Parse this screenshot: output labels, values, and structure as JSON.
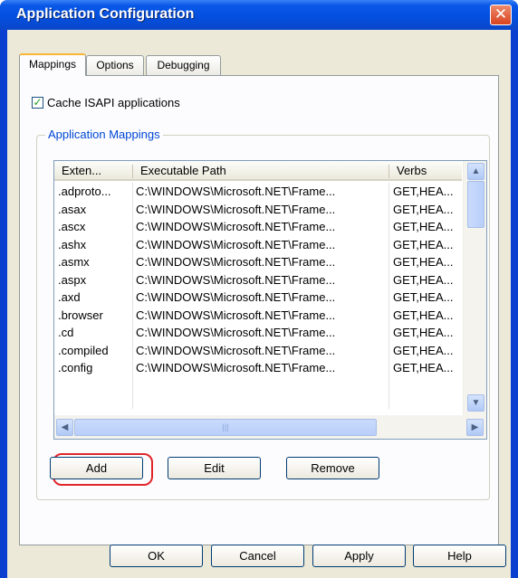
{
  "window": {
    "title": "Application Configuration",
    "close_glyph": "✕"
  },
  "tabs": [
    {
      "label": "Mappings",
      "active": true
    },
    {
      "label": "Options",
      "active": false
    },
    {
      "label": "Debugging",
      "active": false
    }
  ],
  "cache_checkbox": {
    "label": "Cache ISAPI applications",
    "checked": true,
    "check_glyph": "✓"
  },
  "group": {
    "title": "Application Mappings"
  },
  "mappings": {
    "columns": [
      "Exten...",
      "Executable Path",
      "Verbs"
    ],
    "rows": [
      {
        "ext": ".adproto...",
        "path": "C:\\WINDOWS\\Microsoft.NET\\Frame...",
        "verbs": "GET,HEA..."
      },
      {
        "ext": ".asax",
        "path": "C:\\WINDOWS\\Microsoft.NET\\Frame...",
        "verbs": "GET,HEA..."
      },
      {
        "ext": ".ascx",
        "path": "C:\\WINDOWS\\Microsoft.NET\\Frame...",
        "verbs": "GET,HEA..."
      },
      {
        "ext": ".ashx",
        "path": "C:\\WINDOWS\\Microsoft.NET\\Frame...",
        "verbs": "GET,HEA..."
      },
      {
        "ext": ".asmx",
        "path": "C:\\WINDOWS\\Microsoft.NET\\Frame...",
        "verbs": "GET,HEA..."
      },
      {
        "ext": ".aspx",
        "path": "C:\\WINDOWS\\Microsoft.NET\\Frame...",
        "verbs": "GET,HEA..."
      },
      {
        "ext": ".axd",
        "path": "C:\\WINDOWS\\Microsoft.NET\\Frame...",
        "verbs": "GET,HEA..."
      },
      {
        "ext": ".browser",
        "path": "C:\\WINDOWS\\Microsoft.NET\\Frame...",
        "verbs": "GET,HEA..."
      },
      {
        "ext": ".cd",
        "path": "C:\\WINDOWS\\Microsoft.NET\\Frame...",
        "verbs": "GET,HEA..."
      },
      {
        "ext": ".compiled",
        "path": "C:\\WINDOWS\\Microsoft.NET\\Frame...",
        "verbs": "GET,HEA..."
      },
      {
        "ext": ".config",
        "path": "C:\\WINDOWS\\Microsoft.NET\\Frame...",
        "verbs": "GET,HEA..."
      }
    ]
  },
  "scroll": {
    "up": "▲",
    "down": "▼",
    "left": "◀",
    "right": "▶",
    "grip": "|||"
  },
  "mapping_buttons": {
    "add": "Add",
    "edit": "Edit",
    "remove": "Remove"
  },
  "dialog_buttons": {
    "ok": "OK",
    "cancel": "Cancel",
    "apply": "Apply",
    "help": "Help"
  },
  "colors": {
    "title_bar": "#0350e0",
    "close_button": "#d9431f",
    "group_title": "#0046d5",
    "highlight": "#e0262a",
    "face": "#ece9d8"
  }
}
